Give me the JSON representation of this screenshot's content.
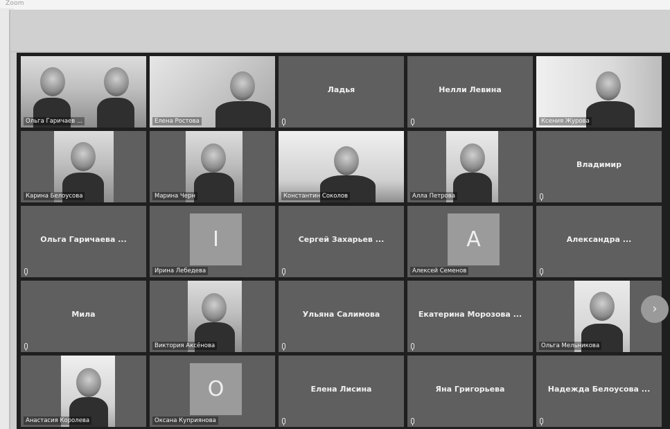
{
  "window": {
    "title": "Zoom"
  },
  "participants": [
    {
      "name": "Ольга Гаричаев ...",
      "type": "video",
      "mic": true
    },
    {
      "name": "Елена Ростова",
      "type": "video",
      "mic": true
    },
    {
      "name": "Ладья",
      "type": "name",
      "mic": true
    },
    {
      "name": "Нелли Левина",
      "type": "name",
      "mic": true
    },
    {
      "name": "Ксения Журова",
      "type": "video",
      "mic": true
    },
    {
      "name": "Карина Белоусова",
      "type": "video",
      "mic": true
    },
    {
      "name": "Марина Черн",
      "type": "video",
      "mic": true
    },
    {
      "name": "Константин Соколов",
      "type": "video",
      "mic": false,
      "active": true
    },
    {
      "name": "Алла Петрова",
      "type": "video",
      "mic": true
    },
    {
      "name": "Владимир",
      "type": "name",
      "mic": true
    },
    {
      "name": "Ольга Гаричаева ...",
      "type": "name",
      "mic": true
    },
    {
      "name": "Ирина Лебедева",
      "type": "avatar",
      "avatar_letter": "I",
      "mic": true
    },
    {
      "name": "Сергей Захарьев ...",
      "type": "name",
      "mic": true
    },
    {
      "name": "Алексей Семенов",
      "type": "avatar",
      "avatar_letter": "A",
      "mic": true
    },
    {
      "name": "Александра ...",
      "type": "name",
      "mic": true
    },
    {
      "name": "Мила",
      "type": "name",
      "mic": true
    },
    {
      "name": "Виктория Аксёнова",
      "type": "video",
      "mic": true
    },
    {
      "name": "Ульяна Салимова",
      "type": "name",
      "mic": true
    },
    {
      "name": "Екатерина Морозова ...",
      "type": "name",
      "mic": true
    },
    {
      "name": "Ольга Мельникова",
      "type": "video",
      "mic": true
    },
    {
      "name": "Анастасия Королева",
      "type": "video",
      "mic": true
    },
    {
      "name": "Оксана Куприянова",
      "type": "avatar",
      "avatar_letter": "O",
      "mic": true
    },
    {
      "name": "Елена Лисина",
      "type": "name",
      "mic": true
    },
    {
      "name": "Яна Григорьева",
      "type": "name",
      "mic": true
    },
    {
      "name": "Надежда Белоусова ...",
      "type": "name",
      "mic": true
    }
  ],
  "controls": {
    "next_page_icon": "chevron-right-icon",
    "next_page_glyph": "›"
  }
}
